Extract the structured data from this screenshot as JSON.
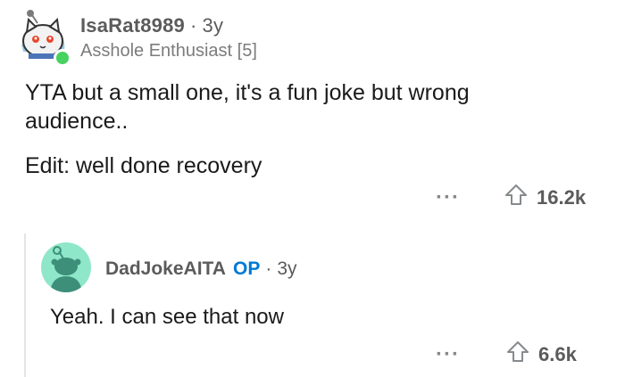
{
  "comment": {
    "username": "IsaRat8989",
    "separator": "·",
    "age": "3y",
    "flair": "Asshole Enthusiast [5]",
    "body_line1": "YTA but a small one, it's a fun joke but wrong audience..",
    "body_line2": "Edit: well done recovery",
    "more_label": "···",
    "upvotes": "16.2k"
  },
  "reply": {
    "username": "DadJokeAITA",
    "op_badge": "OP",
    "separator": "·",
    "age": "3y",
    "body": "Yeah. I can see that now",
    "more_label": "···",
    "upvotes": "6.6k"
  },
  "colors": {
    "online": "#46d160",
    "op_badge": "#0079d3",
    "avatar2_bg": "#8ee7c8"
  }
}
